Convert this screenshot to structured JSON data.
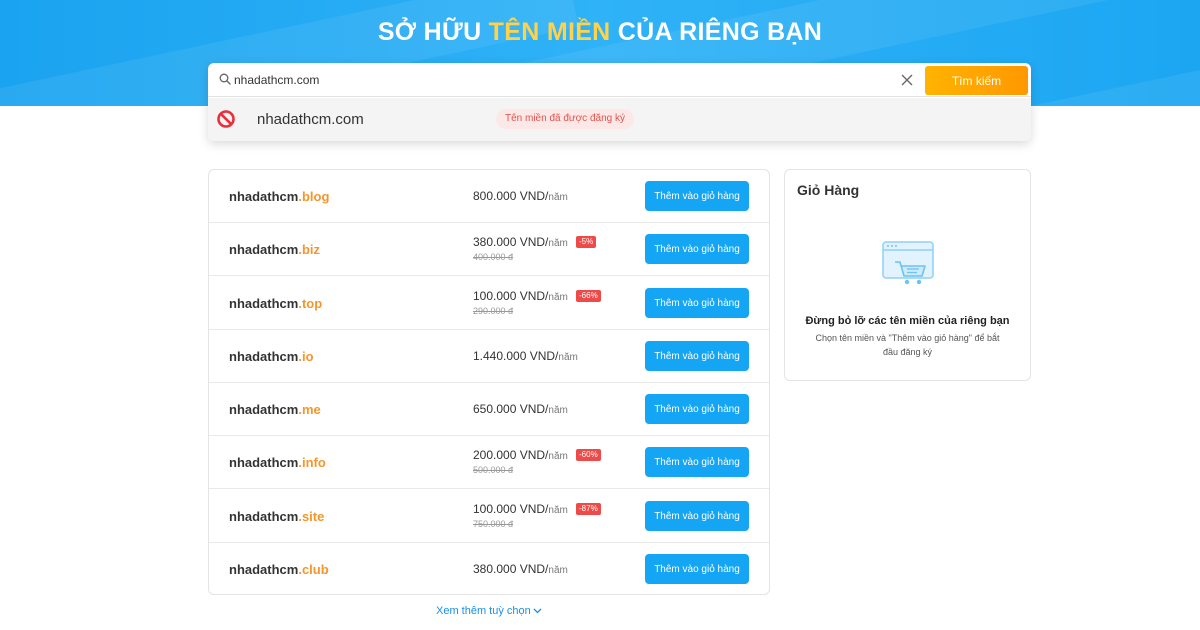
{
  "hero": {
    "title_part1": "SỞ HỮU ",
    "title_highlight": "TÊN MIỀN",
    "title_part2": " CỦA RIÊNG BẠN",
    "highlight_color": "#ffd24a",
    "background_color": "#1aa3f0"
  },
  "search": {
    "value": "nhadathcm.com",
    "button_label": "Tìm kiếm",
    "button_color": "#ffa200",
    "result": {
      "domain": "nhadathcm.com",
      "status": "Tên miền đã được đăng ký",
      "status_icon": "ban-icon"
    }
  },
  "domains": [
    {
      "name": "nhadathcm",
      "tld": ".blog",
      "price": "800.000 VND/",
      "unit": "năm",
      "discount": "",
      "old_price": "",
      "button": "Thêm vào giỏ hàng"
    },
    {
      "name": "nhadathcm",
      "tld": ".biz",
      "price": "380.000 VND/",
      "unit": "năm",
      "discount": "-5%",
      "old_price": "400.000 đ",
      "button": "Thêm vào giỏ hàng"
    },
    {
      "name": "nhadathcm",
      "tld": ".top",
      "price": "100.000 VND/",
      "unit": "năm",
      "discount": "-66%",
      "old_price": "290.000 đ",
      "button": "Thêm vào giỏ hàng"
    },
    {
      "name": "nhadathcm",
      "tld": ".io",
      "price": "1.440.000 VND/",
      "unit": "năm",
      "discount": "",
      "old_price": "",
      "button": "Thêm vào giỏ hàng"
    },
    {
      "name": "nhadathcm",
      "tld": ".me",
      "price": "650.000 VND/",
      "unit": "năm",
      "discount": "",
      "old_price": "",
      "button": "Thêm vào giỏ hàng"
    },
    {
      "name": "nhadathcm",
      "tld": ".info",
      "price": "200.000 VND/",
      "unit": "năm",
      "discount": "-60%",
      "old_price": "500.000 đ",
      "button": "Thêm vào giỏ hàng"
    },
    {
      "name": "nhadathcm",
      "tld": ".site",
      "price": "100.000 VND/",
      "unit": "năm",
      "discount": "-87%",
      "old_price": "750.000 đ",
      "button": "Thêm vào giỏ hàng"
    },
    {
      "name": "nhadathcm",
      "tld": ".club",
      "price": "380.000 VND/",
      "unit": "năm",
      "discount": "",
      "old_price": "",
      "button": "Thêm vào giỏ hàng"
    }
  ],
  "more_options": "Xem thêm tuỳ chọn",
  "cart": {
    "title": "Giỏ Hàng",
    "empty_heading": "Đừng bỏ lỡ các tên miền của riêng bạn",
    "empty_text": "Chọn tên miền và \"Thêm vào giỏ hàng\" để bắt đầu đăng ký",
    "icon": "cart-icon"
  },
  "colors": {
    "tld": "#f5952b",
    "add_button": "#14a5f5",
    "discount_badge": "#ef4a4a",
    "link": "#1a8fe8"
  }
}
